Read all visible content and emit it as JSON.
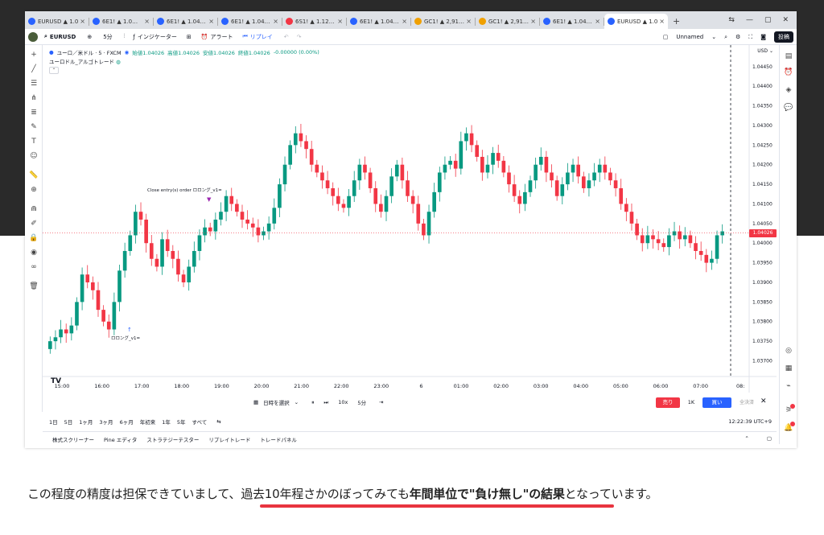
{
  "browser": {
    "tabs": [
      {
        "label": "EURUSD ▲ 1.0…",
        "color": "#2962ff"
      },
      {
        "label": "6E1! ▲ 1.0…",
        "color": "#2962ff"
      },
      {
        "label": "6E1! ▲ 1.04…",
        "color": "#2962ff"
      },
      {
        "label": "6E1! ▲ 1.04…",
        "color": "#2962ff"
      },
      {
        "label": "6S1! ▲ 1.12…",
        "color": "#f23645"
      },
      {
        "label": "6E1! ▲ 1.04…",
        "color": "#2962ff"
      },
      {
        "label": "GC1! ▲ 2,91…",
        "color": "#f0a000"
      },
      {
        "label": "GC1! ▲ 2,91…",
        "color": "#f0a000"
      },
      {
        "label": "6E1! ▲ 1.04…",
        "color": "#2962ff"
      },
      {
        "label": "EURUSD ▲ 1.0…",
        "color": "#2962ff",
        "active": true
      }
    ],
    "tab_close": "×",
    "new_tab": "+",
    "window_controls": {
      "cast": "⇆",
      "minimize": "—",
      "maximize": "▢",
      "close": "✕"
    }
  },
  "toolbar": {
    "symbol": "EURUSD",
    "add_symbol": "⊕",
    "interval": "5分",
    "chart_style": "⫶",
    "indicators": "インジケーター",
    "templates": "⊞",
    "alert": "アラート",
    "replay": "リプレイ",
    "undo": "↶",
    "redo": "↷",
    "layout_name": "Unnamed",
    "publish": "投稿"
  },
  "legend": {
    "title": "ユーロ／米ドル · 5 · FXCM",
    "open": "始値1.04026",
    "high": "高値1.04026",
    "low": "安値1.04026",
    "close": "終値1.04026",
    "change": "-0.00000 (0.00%)",
    "strategy": "ユーロドル_アルゴトレード"
  },
  "currency": "USD",
  "current_price": "1.04026",
  "annotations": {
    "close_entry": "Close entry(s) order ロロング_v1=",
    "long_entry": "ロロング_v1="
  },
  "replay_bar": {
    "select_date": "日時を選択",
    "speed": "10x",
    "step": "5分",
    "sell": "売り",
    "qty": "1K",
    "buy": "買い",
    "close_all": "全決済"
  },
  "ranges": [
    "1日",
    "5日",
    "1ヶ月",
    "3ヶ月",
    "6ヶ月",
    "年初来",
    "1年",
    "5年",
    "すべて"
  ],
  "clock": "12:22:39 UTC+9",
  "bottom_tabs": [
    "株式スクリーナー",
    "Pine エディタ",
    "ストラテジーテスター",
    "リプレイトレード",
    "トレードパネル"
  ],
  "caption": {
    "part1": "この程度の精度は担保できていまして、",
    "part2": "過去10年程さかのぼってみても",
    "part3": "年間単位で\"負け無し\"の結果",
    "part4": "となっています。"
  },
  "chart_data": {
    "type": "candlestick",
    "x_ticks": [
      "15:00",
      "16:00",
      "17:00",
      "18:00",
      "19:00",
      "20:00",
      "21:00",
      "22:00",
      "23:00",
      "6",
      "01:00",
      "02:00",
      "03:00",
      "04:00",
      "05:00",
      "06:00",
      "07:00",
      "08:"
    ],
    "y_ticks": [
      1.0445,
      1.044,
      1.0435,
      1.043,
      1.0425,
      1.042,
      1.0415,
      1.041,
      1.0405,
      1.04,
      1.0395,
      1.039,
      1.0385,
      1.038,
      1.0375,
      1.037
    ],
    "ylim": [
      1.0366,
      1.04505
    ],
    "current_price": 1.04026,
    "series": [
      {
        "name": "EURUSD",
        "x_start": "14:55",
        "x_step_minutes": 5,
        "values": [
          1.0375,
          1.0376,
          1.0378,
          1.0377,
          1.0379,
          1.0385,
          1.0392,
          1.039,
          1.0388,
          1.0383,
          1.038,
          1.0378,
          1.0385,
          1.0393,
          1.0398,
          1.0402,
          1.0408,
          1.0406,
          1.04,
          1.0396,
          1.0394,
          1.0401,
          1.0398,
          1.0396,
          1.0392,
          1.039,
          1.0394,
          1.0398,
          1.0402,
          1.0404,
          1.0403,
          1.0406,
          1.0408,
          1.0412,
          1.041,
          1.0408,
          1.0406,
          1.0405,
          1.0404,
          1.0402,
          1.0403,
          1.0405,
          1.0409,
          1.0415,
          1.042,
          1.0425,
          1.0428,
          1.0426,
          1.0424,
          1.042,
          1.0418,
          1.0416,
          1.0414,
          1.0412,
          1.041,
          1.0409,
          1.0412,
          1.0416,
          1.042,
          1.0418,
          1.0414,
          1.041,
          1.0408,
          1.0412,
          1.0417,
          1.042,
          1.0416,
          1.0412,
          1.041,
          1.0405,
          1.0402,
          1.0408,
          1.0413,
          1.0418,
          1.042,
          1.0421,
          1.0419,
          1.0426,
          1.0428,
          1.0425,
          1.0422,
          1.0418,
          1.042,
          1.0423,
          1.0421,
          1.0418,
          1.0415,
          1.0412,
          1.041,
          1.0413,
          1.0416,
          1.042,
          1.0422,
          1.0418,
          1.0416,
          1.0412,
          1.0415,
          1.0418,
          1.042,
          1.0417,
          1.0414,
          1.0416,
          1.0418,
          1.042,
          1.0418,
          1.0416,
          1.0414,
          1.041,
          1.0408,
          1.0405,
          1.0402,
          1.04,
          1.0402,
          1.0401,
          1.04,
          1.0399,
          1.0402,
          1.0403,
          1.0401,
          1.0402,
          1.04,
          1.0398,
          1.0397,
          1.0395,
          1.0396,
          1.0402,
          1.0403
        ]
      }
    ]
  }
}
